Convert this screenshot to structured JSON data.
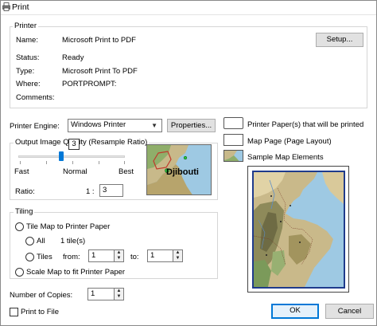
{
  "window": {
    "title": "Print"
  },
  "printer_group": {
    "legend": "Printer",
    "name_label": "Name:",
    "name_value": "Microsoft Print to PDF",
    "setup_label": "Setup...",
    "status_label": "Status:",
    "status_value": "Ready",
    "type_label": "Type:",
    "type_value": "Microsoft Print To PDF",
    "where_label": "Where:",
    "where_value": "PORTPROMPT:",
    "comments_label": "Comments:"
  },
  "engine": {
    "label": "Printer Engine:",
    "value": "Windows Printer",
    "properties_label": "Properties..."
  },
  "quality": {
    "legend": "Output Image Quality (Resample Ratio)",
    "tooltip": "3",
    "fast": "Fast",
    "normal": "Normal",
    "best": "Best",
    "slider_position_fraction": 0.4,
    "ratio_label": "Ratio:",
    "ratio_prefix": "1 :",
    "ratio_value": "3",
    "preview_label": "Djibouti"
  },
  "tiling": {
    "legend": "Tiling",
    "tile_label": "Tile Map to Printer Paper",
    "all_label": "All",
    "tile_count": "1 tile(s)",
    "tiles_label": "Tiles",
    "from_label": "from:",
    "from_value": "1",
    "to_label": "to:",
    "to_value": "1",
    "scale_label": "Scale Map to fit Printer Paper"
  },
  "copies": {
    "label": "Number of Copies:",
    "value": "1"
  },
  "print_to_file": {
    "label": "Print to File"
  },
  "legend_items": {
    "paper": "Printer Paper(s) that will be printed",
    "page": "Map Page (Page Layout)",
    "sample": "Sample Map Elements"
  },
  "buttons": {
    "ok": "OK",
    "cancel": "Cancel"
  },
  "colors": {
    "accent": "#0078d7",
    "map_frame": "#1f3b8c",
    "sea": "#9ec9e3"
  }
}
